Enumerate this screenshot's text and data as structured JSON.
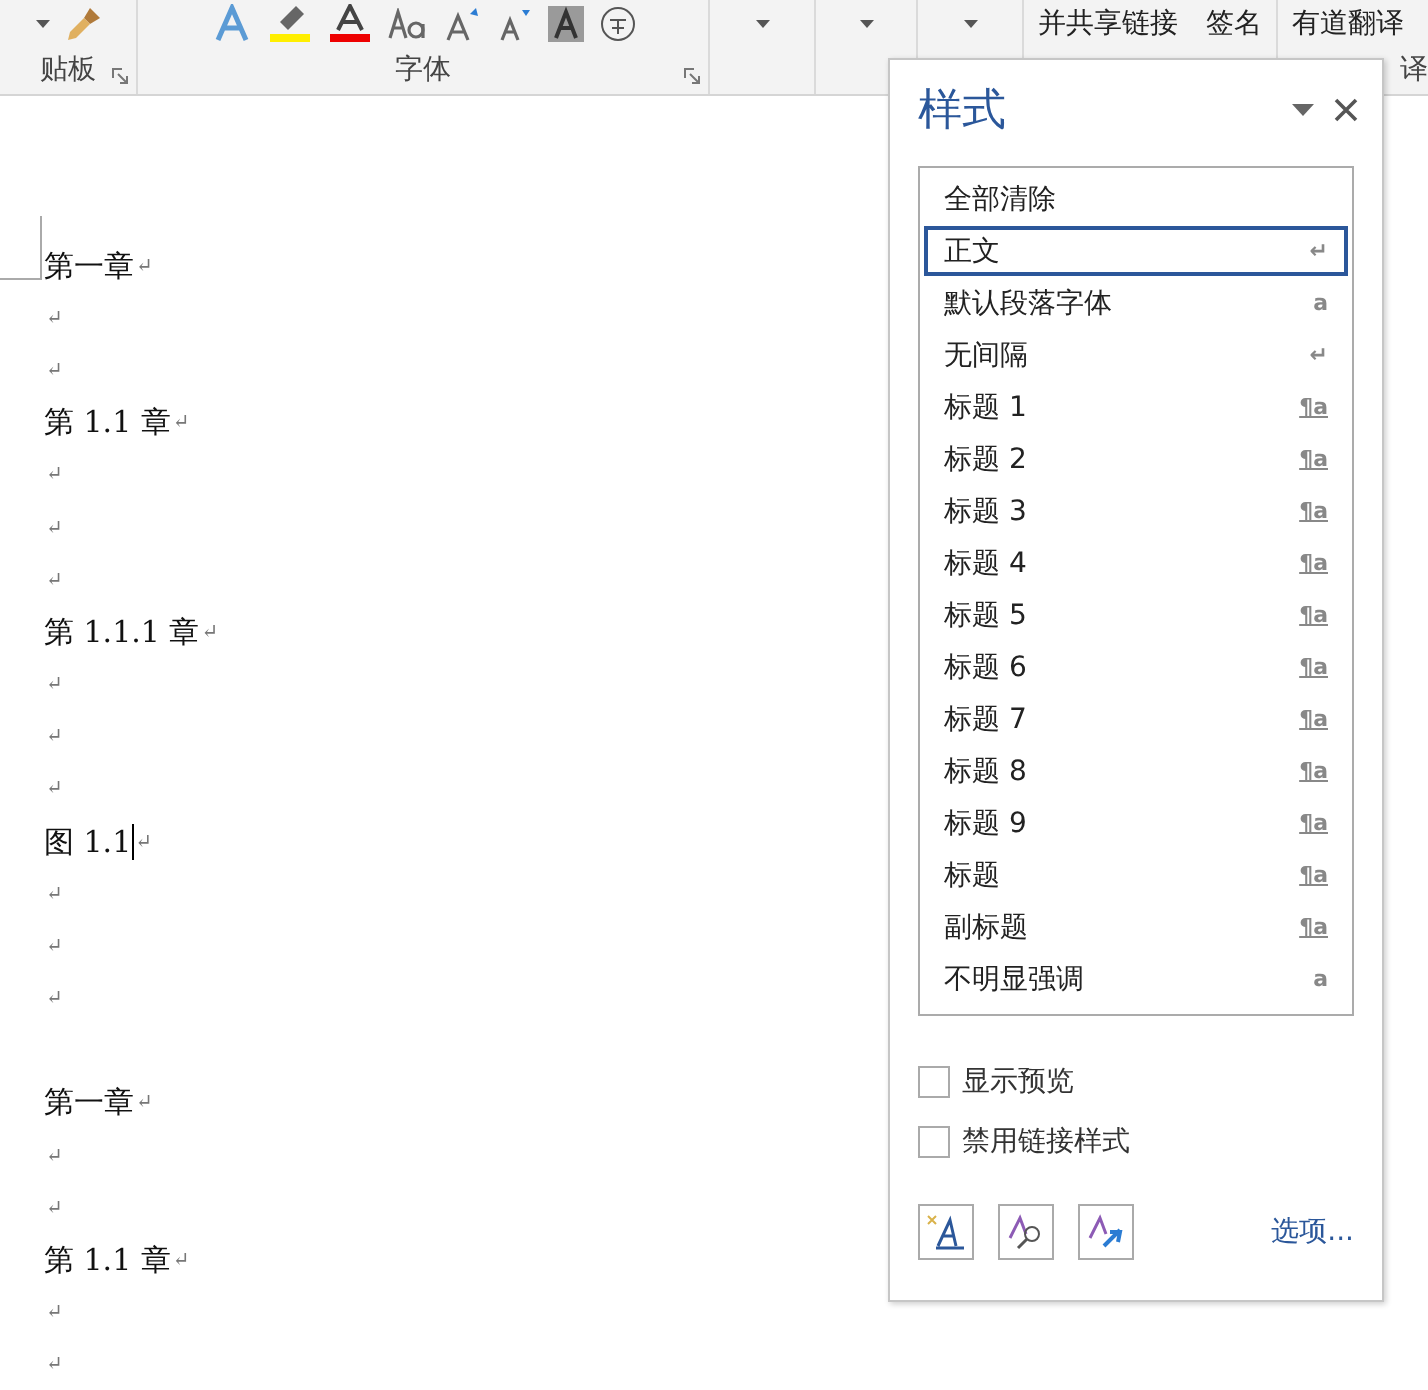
{
  "ribbon": {
    "clipboard_label": "贴板",
    "font_label": "字体",
    "commands": [
      "并共享链接",
      "签名",
      "有道翻译"
    ],
    "translate_label": "译"
  },
  "document": {
    "paragraphs": [
      {
        "text": "第一章",
        "mark": "↵"
      },
      {
        "mark": "↵"
      },
      {
        "mark": "↵"
      },
      {
        "text": "第 1.1 章",
        "mark": "↵"
      },
      {
        "mark": "↵"
      },
      {
        "mark": "↵"
      },
      {
        "mark": "↵"
      },
      {
        "text": "第 1.1.1 章",
        "mark": "↵"
      },
      {
        "mark": "↵"
      },
      {
        "mark": "↵"
      },
      {
        "mark": "↵"
      },
      {
        "text": "图 1.1",
        "mark": "↵",
        "cursor": true
      },
      {
        "mark": "↵"
      },
      {
        "mark": "↵"
      },
      {
        "mark": "↵"
      },
      {
        "text": "第一章",
        "mark": "↵",
        "gap_before": true
      },
      {
        "mark": "↵"
      },
      {
        "mark": "↵"
      },
      {
        "text": "第 1.1 章",
        "mark": "↵"
      },
      {
        "mark": "↵"
      },
      {
        "mark": "↵"
      }
    ]
  },
  "styles_pane": {
    "title": "样式",
    "styles": [
      {
        "name": "全部清除",
        "kind": "none",
        "selected": false
      },
      {
        "name": "正文",
        "kind": "paragraph",
        "glyph": "↵",
        "selected": true
      },
      {
        "name": "默认段落字体",
        "kind": "character",
        "glyph": "a",
        "selected": false
      },
      {
        "name": "无间隔",
        "kind": "paragraph",
        "glyph": "↵",
        "selected": false
      },
      {
        "name": "标题 1",
        "kind": "linked",
        "glyph": "¶a",
        "selected": false
      },
      {
        "name": "标题 2",
        "kind": "linked",
        "glyph": "¶a",
        "selected": false
      },
      {
        "name": "标题 3",
        "kind": "linked",
        "glyph": "¶a",
        "selected": false
      },
      {
        "name": "标题 4",
        "kind": "linked",
        "glyph": "¶a",
        "selected": false
      },
      {
        "name": "标题 5",
        "kind": "linked",
        "glyph": "¶a",
        "selected": false
      },
      {
        "name": "标题 6",
        "kind": "linked",
        "glyph": "¶a",
        "selected": false
      },
      {
        "name": "标题 7",
        "kind": "linked",
        "glyph": "¶a",
        "selected": false
      },
      {
        "name": "标题 8",
        "kind": "linked",
        "glyph": "¶a",
        "selected": false
      },
      {
        "name": "标题 9",
        "kind": "linked",
        "glyph": "¶a",
        "selected": false
      },
      {
        "name": "标题",
        "kind": "linked",
        "glyph": "¶a",
        "selected": false
      },
      {
        "name": "副标题",
        "kind": "linked",
        "glyph": "¶a",
        "selected": false
      },
      {
        "name": "不明显强调",
        "kind": "character",
        "glyph": "a",
        "selected": false
      }
    ],
    "options": [
      {
        "label": "显示预览",
        "checked": false
      },
      {
        "label": "禁用链接样式",
        "checked": false
      }
    ],
    "link": "选项..."
  }
}
